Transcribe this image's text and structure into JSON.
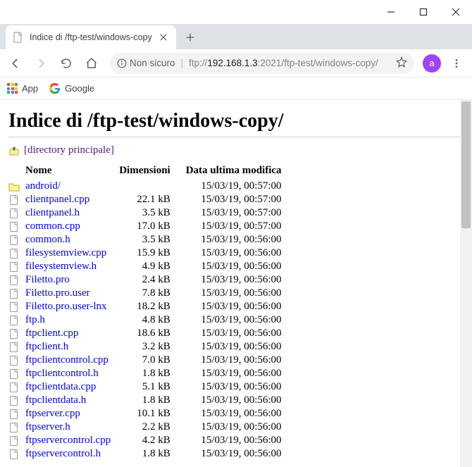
{
  "window": {
    "minimize": "–",
    "maximize": "▢",
    "close": "✕"
  },
  "tab": {
    "title": "Indice di /ftp-test/windows-copy"
  },
  "toolbar": {
    "insecure_label": "Non sicuro",
    "url_scheme": "ftp://",
    "url_host": "192.168.1.3",
    "url_port": ":2021",
    "url_path": "/ftp-test/windows-copy/"
  },
  "avatar": {
    "letter": "a"
  },
  "bookmarks": {
    "apps": "App",
    "google": "Google"
  },
  "page": {
    "heading": "Indice di /ftp-test/windows-copy/",
    "parent_link": "[directory principale]",
    "columns": {
      "name": "Nome",
      "size": "Dimensioni",
      "date": "Data ultima modifica"
    }
  },
  "files": [
    {
      "type": "dir",
      "name": "android/",
      "size": "",
      "date": "15/03/19, 00:57:00"
    },
    {
      "type": "file",
      "name": "clientpanel.cpp",
      "size": "22.1 kB",
      "date": "15/03/19, 00:57:00"
    },
    {
      "type": "file",
      "name": "clientpanel.h",
      "size": "3.5 kB",
      "date": "15/03/19, 00:57:00"
    },
    {
      "type": "file",
      "name": "common.cpp",
      "size": "17.0 kB",
      "date": "15/03/19, 00:57:00"
    },
    {
      "type": "file",
      "name": "common.h",
      "size": "3.5 kB",
      "date": "15/03/19, 00:56:00"
    },
    {
      "type": "file",
      "name": "filesystemview.cpp",
      "size": "15.9 kB",
      "date": "15/03/19, 00:56:00"
    },
    {
      "type": "file",
      "name": "filesystemview.h",
      "size": "4.9 kB",
      "date": "15/03/19, 00:56:00"
    },
    {
      "type": "file",
      "name": "Filetto.pro",
      "size": "2.4 kB",
      "date": "15/03/19, 00:56:00"
    },
    {
      "type": "file",
      "name": "Filetto.pro.user",
      "size": "7.8 kB",
      "date": "15/03/19, 00:56:00"
    },
    {
      "type": "file",
      "name": "Filetto.pro.user-lnx",
      "size": "18.2 kB",
      "date": "15/03/19, 00:56:00"
    },
    {
      "type": "file",
      "name": "ftp.h",
      "size": "4.8 kB",
      "date": "15/03/19, 00:56:00"
    },
    {
      "type": "file",
      "name": "ftpclient.cpp",
      "size": "18.6 kB",
      "date": "15/03/19, 00:56:00"
    },
    {
      "type": "file",
      "name": "ftpclient.h",
      "size": "3.2 kB",
      "date": "15/03/19, 00:56:00"
    },
    {
      "type": "file",
      "name": "ftpclientcontrol.cpp",
      "size": "7.0 kB",
      "date": "15/03/19, 00:56:00"
    },
    {
      "type": "file",
      "name": "ftpclientcontrol.h",
      "size": "1.8 kB",
      "date": "15/03/19, 00:56:00"
    },
    {
      "type": "file",
      "name": "ftpclientdata.cpp",
      "size": "5.1 kB",
      "date": "15/03/19, 00:56:00"
    },
    {
      "type": "file",
      "name": "ftpclientdata.h",
      "size": "1.8 kB",
      "date": "15/03/19, 00:56:00"
    },
    {
      "type": "file",
      "name": "ftpserver.cpp",
      "size": "10.1 kB",
      "date": "15/03/19, 00:56:00"
    },
    {
      "type": "file",
      "name": "ftpserver.h",
      "size": "2.2 kB",
      "date": "15/03/19, 00:56:00"
    },
    {
      "type": "file",
      "name": "ftpservercontrol.cpp",
      "size": "4.2 kB",
      "date": "15/03/19, 00:56:00"
    },
    {
      "type": "file",
      "name": "ftpservercontrol.h",
      "size": "1.8 kB",
      "date": "15/03/19, 00:56:00"
    }
  ]
}
